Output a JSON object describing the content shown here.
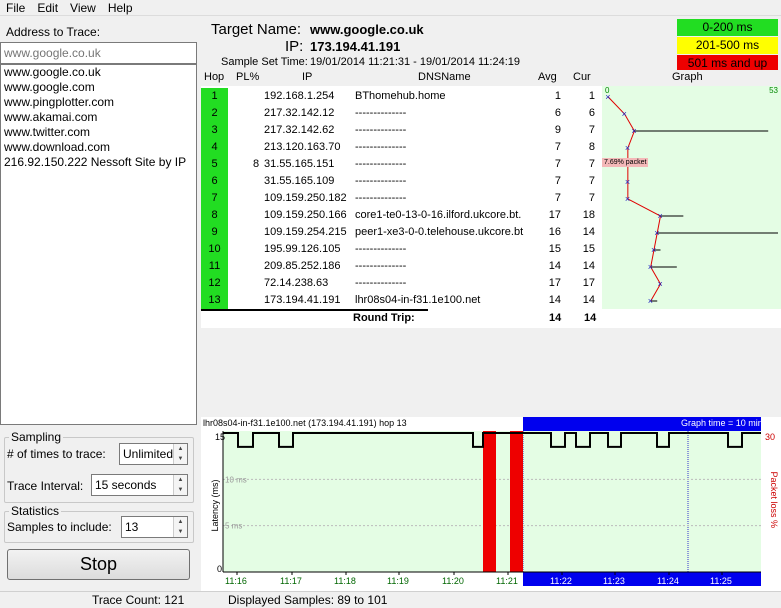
{
  "menu": [
    "File",
    "Edit",
    "View",
    "Help"
  ],
  "left": {
    "address_label": "Address to Trace:",
    "address_placeholder": "www.google.co.uk",
    "hosts": [
      "www.google.co.uk",
      "www.google.com",
      "www.pingplotter.com",
      "www.akamai.com",
      "www.twitter.com",
      "www.download.com",
      "216.92.150.222 Nessoft Site by IP"
    ],
    "sampling_title": "Sampling",
    "times_label": "# of times to trace:",
    "times_value": "Unlimited",
    "interval_label": "Trace Interval:",
    "interval_value": "15 seconds",
    "statistics_title": "Statistics",
    "samples_label": "Samples to include:",
    "samples_value": "13",
    "stop_label": "Stop"
  },
  "header": {
    "target_label": "Target Name:",
    "target_value": "www.google.co.uk",
    "ip_label": "IP:",
    "ip_value": "173.194.41.191",
    "sample_label": "Sample Set Time:",
    "sample_value": "19/01/2014 11:21:31 - 19/01/2014 11:24:19"
  },
  "legend": [
    {
      "text": "0-200 ms",
      "color": "#22dd22"
    },
    {
      "text": "201-500 ms",
      "color": "#ffff00"
    },
    {
      "text": "501 ms and up",
      "color": "#ee0000"
    }
  ],
  "columns": {
    "hop": "Hop",
    "pl": "PL%",
    "ip": "IP",
    "dns": "DNSName",
    "avg": "Avg",
    "cur": "Cur",
    "graph": "Graph"
  },
  "hops": [
    {
      "hop": "1",
      "pl": "",
      "ip": "192.168.1.254",
      "dns": "BThomehub.home",
      "avg": "1",
      "cur": "1"
    },
    {
      "hop": "2",
      "pl": "",
      "ip": "217.32.142.12",
      "dns": "--------------",
      "avg": "6",
      "cur": "6"
    },
    {
      "hop": "3",
      "pl": "",
      "ip": "217.32.142.62",
      "dns": "--------------",
      "avg": "9",
      "cur": "7"
    },
    {
      "hop": "4",
      "pl": "",
      "ip": "213.120.163.70",
      "dns": "--------------",
      "avg": "7",
      "cur": "8"
    },
    {
      "hop": "5",
      "pl": "8",
      "ip": "31.55.165.151",
      "dns": "--------------",
      "avg": "7",
      "cur": "7"
    },
    {
      "hop": "6",
      "pl": "",
      "ip": "31.55.165.109",
      "dns": "--------------",
      "avg": "7",
      "cur": "7"
    },
    {
      "hop": "7",
      "pl": "",
      "ip": "109.159.250.182",
      "dns": "--------------",
      "avg": "7",
      "cur": "7"
    },
    {
      "hop": "8",
      "pl": "",
      "ip": "109.159.250.166",
      "dns": "core1-te0-13-0-16.ilford.ukcore.bt.",
      "avg": "17",
      "cur": "18"
    },
    {
      "hop": "9",
      "pl": "",
      "ip": "109.159.254.215",
      "dns": "peer1-xe3-0-0.telehouse.ukcore.bt",
      "avg": "16",
      "cur": "14"
    },
    {
      "hop": "10",
      "pl": "",
      "ip": "195.99.126.105",
      "dns": "--------------",
      "avg": "15",
      "cur": "15"
    },
    {
      "hop": "11",
      "pl": "",
      "ip": "209.85.252.186",
      "dns": "--------------",
      "avg": "14",
      "cur": "14"
    },
    {
      "hop": "12",
      "pl": "",
      "ip": "72.14.238.63",
      "dns": "--------------",
      "avg": "17",
      "cur": "17"
    },
    {
      "hop": "13",
      "pl": "",
      "ip": "173.194.41.191",
      "dns": "lhr08s04-in-f31.1e100.net",
      "avg": "14",
      "cur": "14"
    }
  ],
  "round_trip": {
    "label": "Round Trip:",
    "avg": "14",
    "cur": "14"
  },
  "graph": {
    "min": "0",
    "max": "53",
    "packet_label": "7.69% packet",
    "avg_ms": [
      1,
      6,
      9,
      7,
      7,
      7,
      7,
      17,
      16,
      15,
      14,
      17,
      14
    ],
    "max_ms": [
      1,
      6,
      50,
      7,
      7,
      7,
      7,
      24,
      70,
      17,
      22,
      17,
      16
    ]
  },
  "bottom": {
    "title": "lhr08s04-in-f31.1e100.net (173.194.41.191) hop 13",
    "graph_time": "Graph time = 10 minutes",
    "y_left_max": "15",
    "y_left_zero": "0",
    "y_right_max": "30",
    "y_label": "Latency (ms)",
    "right_label": "Packet loss %",
    "gridlabels": [
      "10 ms",
      "5 ms"
    ],
    "times": [
      "11:16",
      "11:17",
      "11:18",
      "11:19",
      "11:20",
      "11:21",
      "11:22",
      "11:23",
      "11:24",
      "11:25"
    ]
  },
  "status": {
    "trace_count": "Trace Count: 121",
    "displayed": "Displayed Samples: 89 to 101"
  }
}
